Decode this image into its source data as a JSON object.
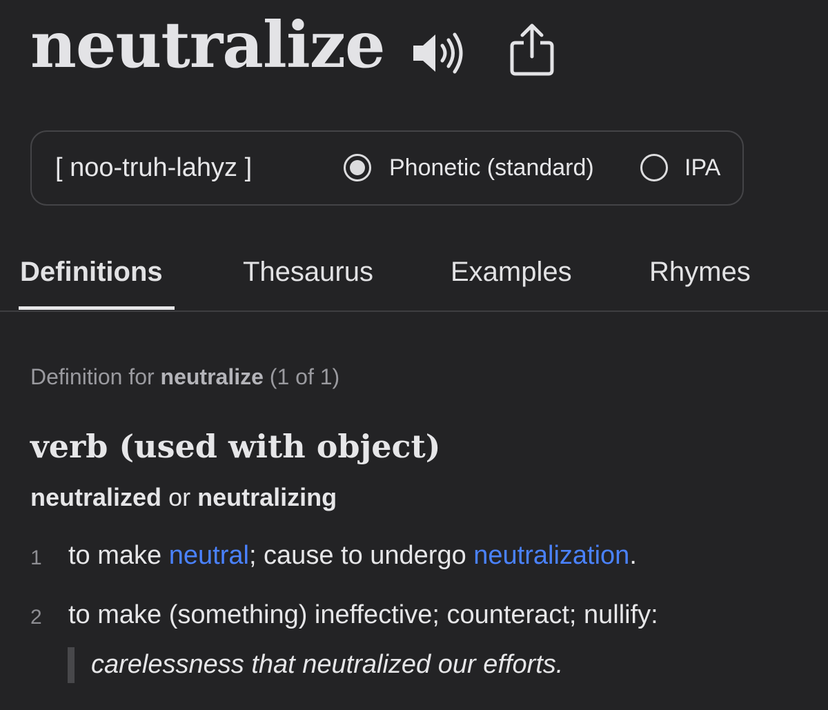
{
  "entry": {
    "headword": "neutralize",
    "pronunciation": "[ noo-truh-lahyz ]",
    "pron_options": {
      "phonetic_label": "Phonetic (standard)",
      "ipa_label": "IPA",
      "selected": "Phonetic (standard)"
    }
  },
  "tabs": [
    {
      "label": "Definitions",
      "active": true
    },
    {
      "label": "Thesaurus",
      "active": false
    },
    {
      "label": "Examples",
      "active": false
    },
    {
      "label": "Rhymes",
      "active": false
    }
  ],
  "definition": {
    "header_prefix": "Definition for",
    "header_word": "neutralize",
    "header_count": "(1 of 1)",
    "part_of_speech": "verb (used with object)",
    "form1": "neutralized",
    "form_sep": "or",
    "form2": "neutralizing",
    "senses": [
      {
        "num": "1",
        "text_a": "to make ",
        "link1": "neutral",
        "text_b": "; cause to undergo ",
        "link2": "neutralization",
        "text_c": "."
      },
      {
        "num": "2",
        "text": "to make (something) ineffective; counteract; nullify:",
        "example": "carelessness that neutralized our efforts."
      }
    ]
  },
  "icons": {
    "speaker": "speaker-icon",
    "share": "share-icon"
  },
  "colors": {
    "background": "#232325",
    "link": "#4a82ff",
    "text": "#e6e6e8"
  }
}
